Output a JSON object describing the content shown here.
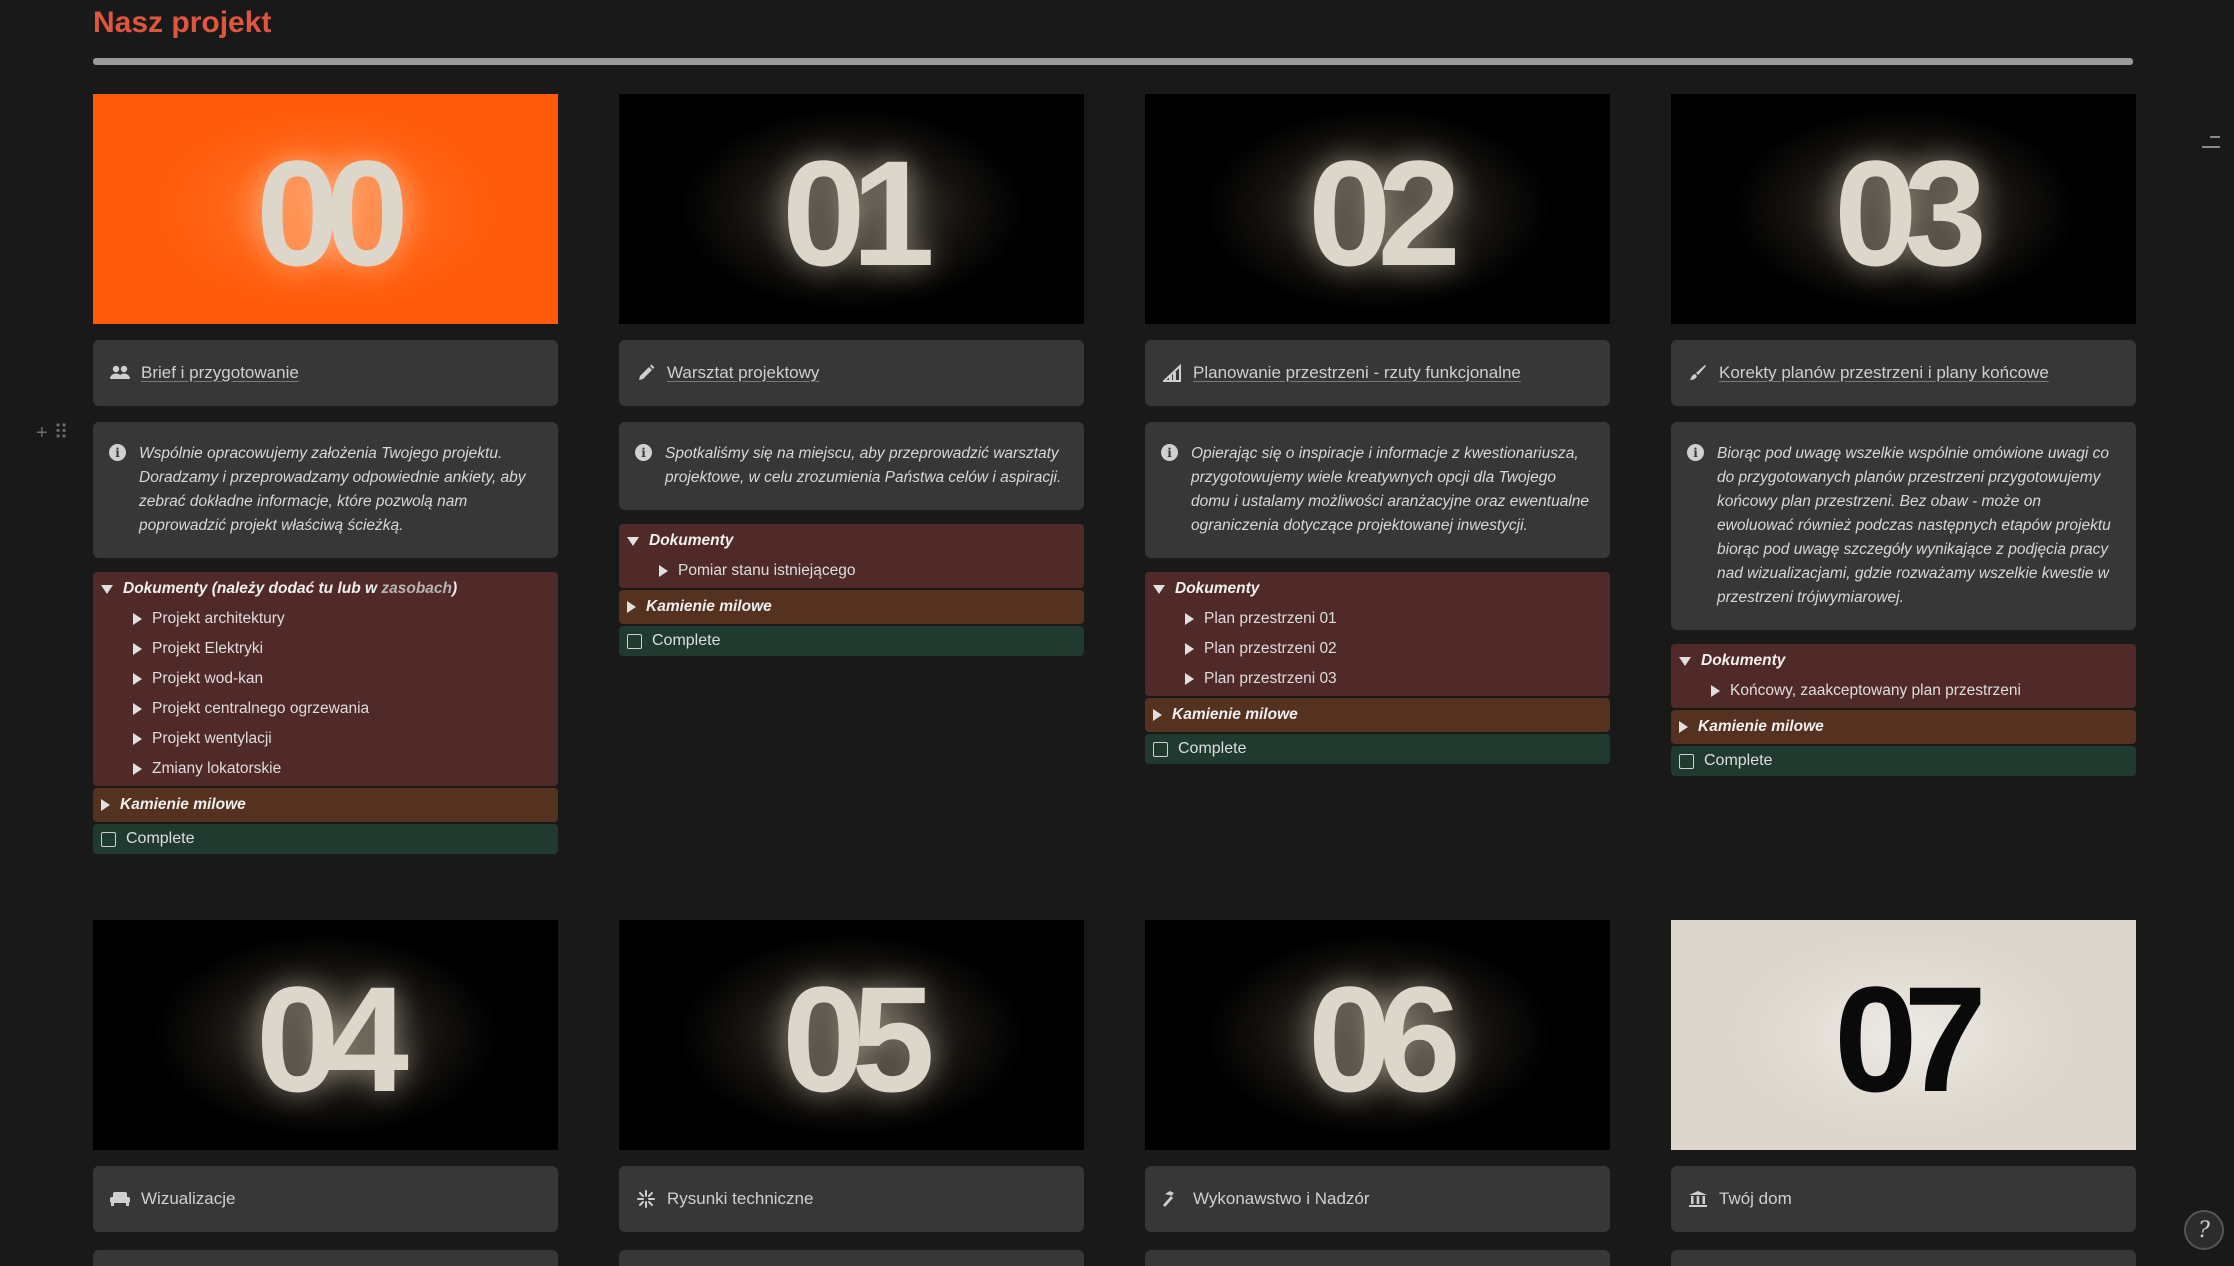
{
  "page": {
    "title": "Nasz projekt"
  },
  "colors": {
    "title": "#e0553e",
    "background": "#191919",
    "orange_cover": "#ff5a09",
    "light_cover": "#dcd6cc"
  },
  "columns": [
    {
      "num": "00",
      "icon": "users-icon",
      "title": "Brief i przygotowanie",
      "callout": "Wspólnie opracowujemy założenia Twojego projektu. Doradzamy i przeprowadzamy odpowiednie ankiety, aby zebrać dokładne informacje, które pozwolą nam poprowadzić projekt właściwą ścieżką.",
      "docs_label_prefix": "Dokumenty (należy dodać tu lub w ",
      "docs_label_link": "zasobach",
      "docs_label_suffix": ")",
      "docs_items": [
        "Projekt architektury",
        "Projekt Elektryki",
        "Projekt wod-kan",
        "Projekt centralnego ogrzewania",
        "Projekt wentylacji",
        "Zmiany lokatorskie"
      ],
      "milestones_label": "Kamienie milowe",
      "complete_label": "Complete"
    },
    {
      "num": "01",
      "icon": "pencil-icon",
      "title": "Warsztat projektowy",
      "callout": "Spotkaliśmy się na miejscu, aby przeprowadzić warsztaty projektowe, w celu zrozumienia Państwa celów i aspiracji.",
      "docs_label": "Dokumenty",
      "docs_items": [
        "Pomiar stanu istniejącego"
      ],
      "milestones_label": "Kamienie milowe",
      "complete_label": "Complete"
    },
    {
      "num": "02",
      "icon": "chart-icon",
      "title": "Planowanie przestrzeni - rzuty funkcjonalne",
      "callout": "Opierając się o inspiracje i informacje z kwestionariusza, przygotowujemy wiele kreatywnych opcji dla Twojego domu i ustalamy możliwości aranżacyjne oraz ewentualne ograniczenia dotyczące projektowanej inwestycji.",
      "docs_label": "Dokumenty",
      "docs_items": [
        "Plan przestrzeni 01",
        "Plan przestrzeni 02",
        "Plan przestrzeni 03"
      ],
      "milestones_label": "Kamienie milowe",
      "complete_label": "Complete"
    },
    {
      "num": "03",
      "icon": "brush-icon",
      "title": "Korekty planów przestrzeni i plany końcowe",
      "callout": "Biorąc pod uwagę wszelkie wspólnie omówione uwagi co do przygotowanych planów przestrzeni przygotowujemy końcowy plan przestrzeni. Bez obaw - może on ewoluować również podczas następnych etapów projektu biorąc pod uwagę szczegóły wynikające z podjęcia pracy nad wizualizacjami, gdzie rozważamy wszelkie kwestie w przestrzeni trójwymiarowej.",
      "docs_label": "Dokumenty",
      "docs_items": [
        "Końcowy, zaakceptowany plan przestrzeni"
      ],
      "milestones_label": "Kamienie milowe",
      "complete_label": "Complete"
    }
  ],
  "bottom": [
    {
      "num": "04",
      "icon": "sofa-icon",
      "title": "Wizualizacje"
    },
    {
      "num": "05",
      "icon": "sparkle-icon",
      "title": "Rysunki techniczne"
    },
    {
      "num": "06",
      "icon": "hammer-icon",
      "title": "Wykonawstwo i Nadzór"
    },
    {
      "num": "07",
      "icon": "building-icon",
      "title": "Twój dom"
    }
  ]
}
